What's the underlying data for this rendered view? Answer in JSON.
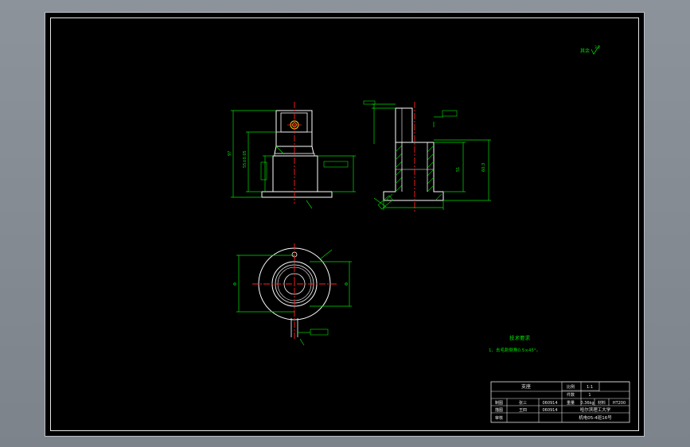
{
  "drawing": {
    "roughness_symbol": "其余",
    "roughness_value": "3.2",
    "notes_title": "技术要求",
    "notes_line1": "1、去毛刺倒角0.5×45°。"
  },
  "title_block": {
    "part_name": "支座",
    "scale_label": "比例",
    "scale_value": "1:1",
    "qty_label": "件数",
    "qty_value": "1",
    "drawn_label": "制图",
    "drawn_name": "张三",
    "drawn_date": "060914",
    "weight_label": "重量",
    "weight_value": "0.36kg",
    "material_label": "材料",
    "material_value": "HT200",
    "checked_label": "描图",
    "checked_name": "王四",
    "checked_date": "060914",
    "approved_label": "审核",
    "school": "哈尔滨理工大学",
    "class": "机电05-4班16号"
  },
  "colors": {
    "outline": "#ffffff",
    "dimension": "#00e000",
    "centerline": "#ff2020",
    "section_hatch": "#00c000",
    "background": "#000000"
  }
}
